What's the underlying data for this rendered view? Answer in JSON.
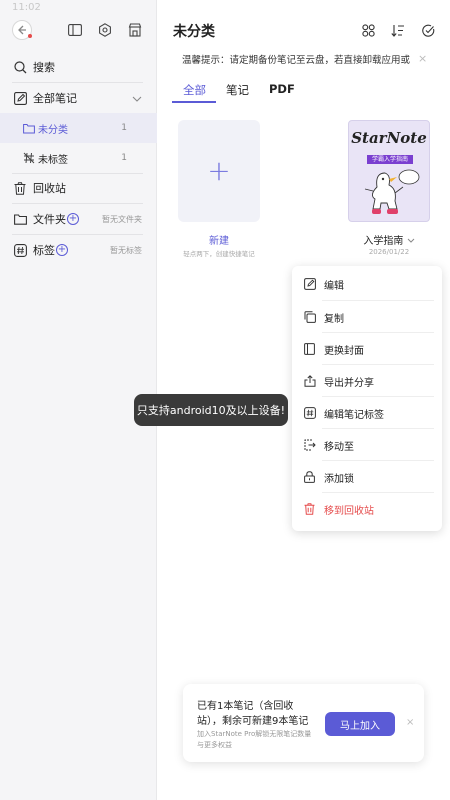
{
  "status": {
    "time": "11:02"
  },
  "sidebar": {
    "search": "搜索",
    "all_notes": "全部笔记",
    "uncategorized": {
      "label": "未分类",
      "count": "1"
    },
    "untagged": {
      "label": "未标签",
      "count": "1"
    },
    "trash": "回收站",
    "folders": {
      "label": "文件夹",
      "hint": "暂无文件夹"
    },
    "tags": {
      "label": "标签",
      "hint": "暂无标签"
    }
  },
  "main": {
    "title": "未分类",
    "notice": "温馨提示：请定期备份笔记至云盘，若直接卸载应用或...",
    "tabs": [
      "全部",
      "笔记",
      "PDF"
    ],
    "new_card": {
      "label": "新建",
      "hint": "轻点两下，创建快捷笔记"
    },
    "note": {
      "title": "入学指南",
      "date": "2026/01/22",
      "cover_title": "StarNote",
      "cover_subtitle": "学霸入学指南"
    }
  },
  "context_menu": {
    "items": [
      "编辑",
      "复制",
      "更换封面",
      "导出并分享",
      "编辑笔记标签",
      "移动至",
      "添加锁",
      "移到回收站"
    ]
  },
  "toast": "只支持android10及以上设备!",
  "promo": {
    "line1": "已有1本笔记（含回收",
    "line2": "站），剩余可新建9本笔记",
    "sub1": "加入StarNote Pro解锁无限笔记数量",
    "sub2": "与更多权益",
    "button": "马上加入"
  },
  "colors": {
    "accent": "#5b5bd6",
    "danger": "#e54b4b"
  }
}
